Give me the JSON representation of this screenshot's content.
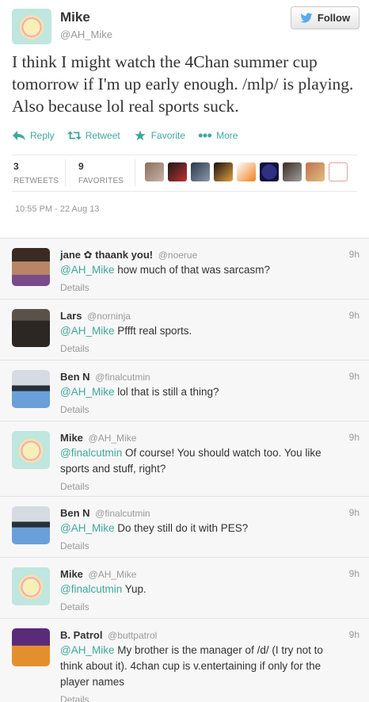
{
  "tweet": {
    "author_name": "Mike",
    "author_handle": "@AH_Mike",
    "follow_label": "Follow",
    "text": "I think I might watch the 4Chan summer cup tomorrow if I'm up early enough. /mlp/ is playing. Also because lol real sports suck.",
    "actions": {
      "reply": "Reply",
      "retweet": "Retweet",
      "favorite": "Favorite",
      "more": "More"
    },
    "stats": {
      "retweets_count": "3",
      "retweets_label": "RETWEETS",
      "favorites_count": "9",
      "favorites_label": "FAVORITES"
    },
    "timestamp": "10:55 PM - 22 Aug 13"
  },
  "replies": [
    {
      "name": "jane ✿ thaank you!",
      "handle": "@noerue",
      "time": "9h",
      "mention": "@AH_Mike",
      "text": " how much of that was sarcasm?",
      "details": "Details",
      "avatar": "jane-avatar"
    },
    {
      "name": "Lars",
      "handle": "@norninja",
      "time": "9h",
      "mention": "@AH_Mike",
      "text": " Pffft real sports.",
      "details": "Details",
      "avatar": "lars-avatar"
    },
    {
      "name": "Ben N",
      "handle": "@finalcutmin",
      "time": "9h",
      "mention": "@AH_Mike",
      "text": " lol that is still a thing?",
      "details": "Details",
      "avatar": "ben-avatar"
    },
    {
      "name": "Mike",
      "handle": "@AH_Mike",
      "time": "9h",
      "mention": "@finalcutmin",
      "text": " Of course! You should watch too. You like sports and stuff, right?",
      "details": "Details",
      "avatar": "mike-avatar"
    },
    {
      "name": "Ben N",
      "handle": "@finalcutmin",
      "time": "9h",
      "mention": "@AH_Mike",
      "text": " Do they still do it with PES?",
      "details": "Details",
      "avatar": "ben-avatar"
    },
    {
      "name": "Mike",
      "handle": "@AH_Mike",
      "time": "9h",
      "mention": "@finalcutmin",
      "text": " Yup.",
      "details": "Details",
      "avatar": "mike-avatar"
    },
    {
      "name": "B. Patrol",
      "handle": "@buttpatrol",
      "time": "9h",
      "mention": "@AH_Mike",
      "text": " My brother is the manager of /d/ (I try not to think about it). 4chan cup is v.entertaining if only for the player names",
      "details": "Details",
      "avatar": "bpatrol-avatar"
    }
  ],
  "colors": {
    "accent": "#3fa89b",
    "twitter_blue": "#55acee",
    "muted": "#999999"
  }
}
